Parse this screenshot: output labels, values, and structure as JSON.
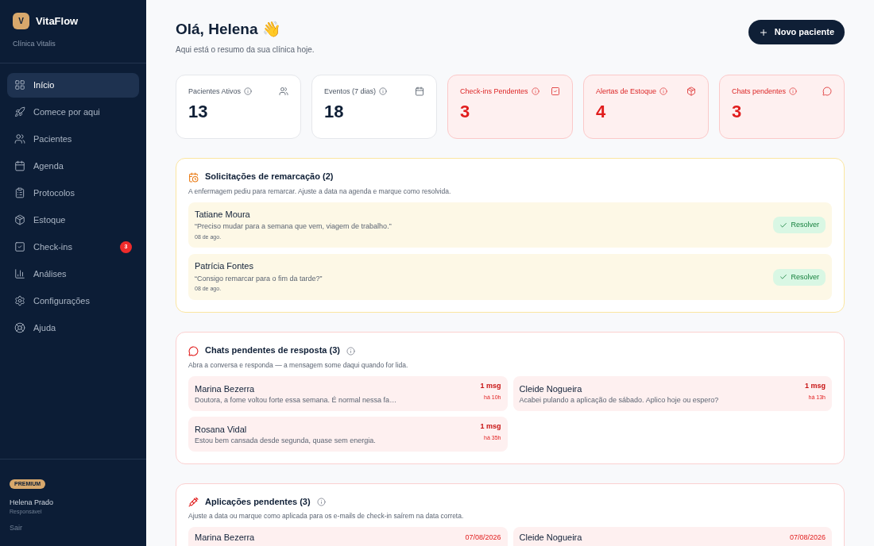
{
  "brand": {
    "logo_letter": "V",
    "name": "VitaFlow",
    "subtitle": "Clínica Vitalis"
  },
  "nav": [
    {
      "label": "Início",
      "selected": true
    },
    {
      "label": "Comece por aqui",
      "selected": false
    },
    {
      "label": "Pacientes",
      "selected": false
    },
    {
      "label": "Agenda",
      "selected": false
    },
    {
      "label": "Protocolos",
      "selected": false
    },
    {
      "label": "Estoque",
      "selected": false
    },
    {
      "label": "Check-ins",
      "selected": false,
      "badge": "3"
    },
    {
      "label": "Análises",
      "selected": false
    },
    {
      "label": "Configurações",
      "selected": false
    },
    {
      "label": "Ajuda",
      "selected": false
    }
  ],
  "user": {
    "plan": "PREMIUM",
    "name": "Helena Prado",
    "role": "Responsável",
    "logout": "Sair"
  },
  "header": {
    "greeting": "Olá, Helena 👋",
    "subtitle": "Aqui está o resumo da sua clínica hoje.",
    "new_button": "Novo paciente"
  },
  "stats": [
    {
      "label": "Pacientes Ativos",
      "value": "13",
      "kind": "neutral"
    },
    {
      "label": "Eventos (7 dias)",
      "value": "18",
      "kind": "neutral"
    },
    {
      "label": "Check-ins Pendentes",
      "value": "3",
      "kind": "alert"
    },
    {
      "label": "Alertas de Estoque",
      "value": "4",
      "kind": "alert"
    },
    {
      "label": "Chats pendentes",
      "value": "3",
      "kind": "alert"
    }
  ],
  "reschedule": {
    "title": "Solicitações de remarcação (2)",
    "description": "A enfermagem pediu para remarcar. Ajuste a data na agenda e marque como resolvida.",
    "items": [
      {
        "name": "Tatiane Moura",
        "quote": "“Preciso mudar para a semana que vem, viagem de trabalho.”",
        "date": "08 de ago.",
        "action": "Resolver"
      },
      {
        "name": "Patrícia Fontes",
        "quote": "“Consigo remarcar para o fim da tarde?”",
        "date": "08 de ago.",
        "action": "Resolver"
      }
    ]
  },
  "chats": {
    "title": "Chats pendentes de resposta (3)",
    "description": "Abra a conversa e responda — a mensagem some daqui quando for lida.",
    "items": [
      {
        "name": "Marina Bezerra",
        "message": "Doutora, a fome voltou forte essa semana. É normal nessa fa…",
        "count": "1 msg",
        "time": "há 10h"
      },
      {
        "name": "Cleide Nogueira",
        "message": "Acabei pulando a aplicação de sábado. Aplico hoje ou espero?",
        "count": "1 msg",
        "time": "há 13h"
      },
      {
        "name": "Rosana Vidal",
        "message": "Estou bem cansada desde segunda, quase sem energia.",
        "count": "1 msg",
        "time": "há 35h"
      }
    ]
  },
  "applications": {
    "title": "Aplicações pendentes (3)",
    "description": "Ajuste a data ou marque como aplicada para os e-mails de check-in saírem na data correta.",
    "items": [
      {
        "name": "Marina Bezerra",
        "date": "07/08/2026"
      },
      {
        "name": "Cleide Nogueira",
        "date": "07/08/2026"
      }
    ]
  }
}
